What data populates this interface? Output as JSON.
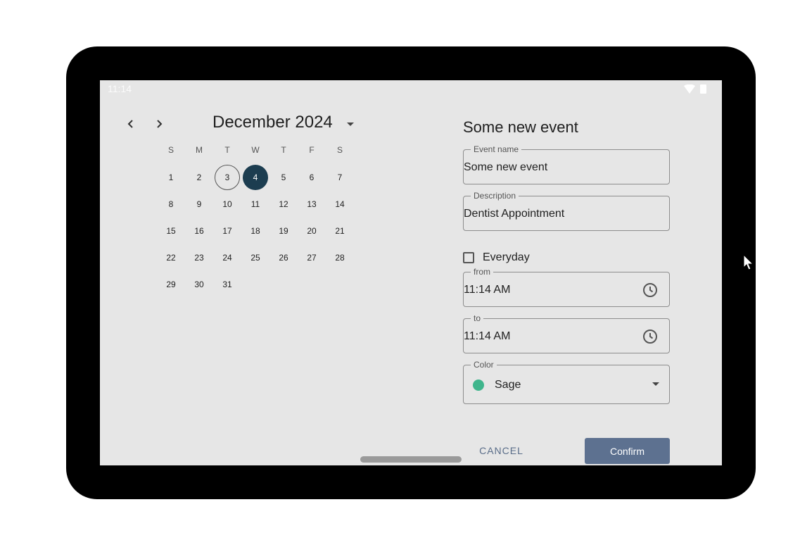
{
  "status_bar": {
    "time": "11:14"
  },
  "calendar": {
    "month_title": "December 2024",
    "weekdays": [
      "S",
      "M",
      "T",
      "W",
      "T",
      "F",
      "S"
    ],
    "weeks": [
      [
        "1",
        "2",
        "3",
        "4",
        "5",
        "6",
        "7"
      ],
      [
        "8",
        "9",
        "10",
        "11",
        "12",
        "13",
        "14"
      ],
      [
        "15",
        "16",
        "17",
        "18",
        "19",
        "20",
        "21"
      ],
      [
        "22",
        "23",
        "24",
        "25",
        "26",
        "27",
        "28"
      ],
      [
        "29",
        "30",
        "31",
        "",
        "",
        "",
        ""
      ]
    ],
    "today": "3",
    "selected": "4"
  },
  "form": {
    "title": "Some new event",
    "event_name": {
      "label": "Event name",
      "value": "Some new event"
    },
    "description": {
      "label": "Description",
      "value": "Dentist Appointment"
    },
    "everyday": {
      "label": "Everyday",
      "checked": false
    },
    "from": {
      "label": "from",
      "value": "11:14 AM"
    },
    "to": {
      "label": "to",
      "value": "11:14 AM"
    },
    "color": {
      "label": "Color",
      "value": "Sage",
      "swatch": "#3fb58c"
    },
    "cancel_label": "CANCEL",
    "confirm_label": "Confirm"
  },
  "colors": {
    "selected_day": "#1c3d50",
    "confirm_button": "#5d7190",
    "cancel_text": "#5a6d89",
    "screen_background": "#e6e6e6"
  }
}
